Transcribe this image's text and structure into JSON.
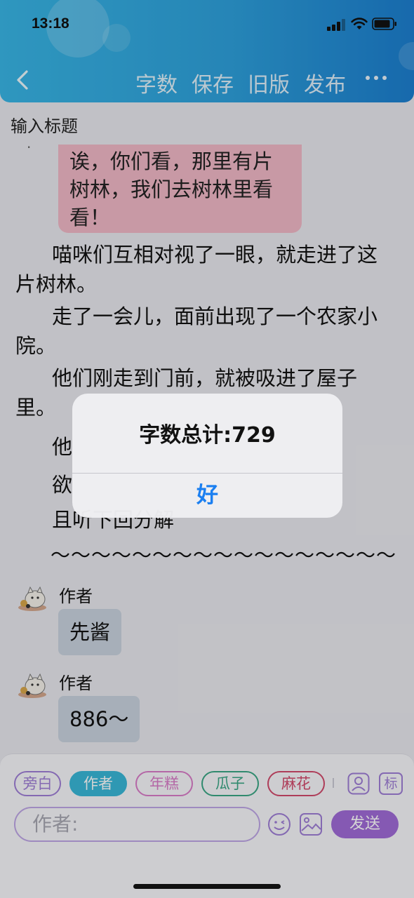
{
  "status_bar": {
    "time": "13:18"
  },
  "header": {
    "menu": [
      "字数",
      "保存",
      "旧版",
      "发布"
    ]
  },
  "title_input": {
    "placeholder": "输入标题"
  },
  "story": {
    "bubble_text": "诶，你们看，那里有片树林，我们去树林里看看！",
    "paragraphs": [
      "喵咪们互相对视了一眼，就走进了这片树林。",
      "走了一会儿，面前出现了一个农家小院。",
      "他们刚走到门前，就被吸进了屋子里。"
    ],
    "fragments": [
      "他",
      "欲",
      "且听下回分解"
    ],
    "separator": "～～～～～～～～～～～～～～～～～",
    "messages": [
      {
        "author": "作者",
        "text": "先酱"
      },
      {
        "author": "作者",
        "text": "886～"
      }
    ]
  },
  "toolbar": {
    "chips": [
      "旁白",
      "作者",
      "年糕",
      "瓜子",
      "麻花"
    ],
    "active_chip": "作者",
    "tag_label": "标",
    "input_placeholder": "作者:",
    "send_label": "发送"
  },
  "alert": {
    "title": "字数总计:729",
    "ok_label": "好"
  },
  "colors": {
    "header_start": "#39b6e6",
    "header_end": "#1c7fd0",
    "alert_button": "#1b7ff1",
    "send_button": "#a06cd8",
    "bubble_pink": "#f1b8c7",
    "message_bubble": "#c9d3df"
  }
}
